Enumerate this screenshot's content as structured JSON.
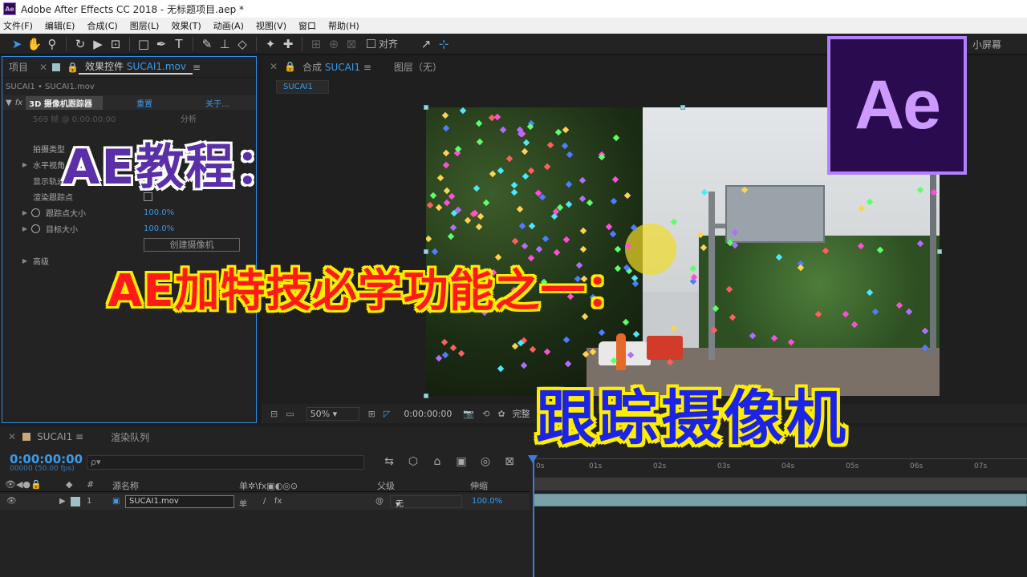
{
  "window": {
    "title": "Adobe After Effects CC 2018 - 无标题项目.aep *",
    "icon_label": "Ae"
  },
  "menubar": [
    "文件(F)",
    "编辑(E)",
    "合成(C)",
    "图层(L)",
    "效果(T)",
    "动画(A)",
    "视图(V)",
    "窗口",
    "帮助(H)"
  ],
  "toolbar": {
    "snap_label": "对齐",
    "small_screen": "小屏幕"
  },
  "left_panel": {
    "tabs": [
      "项目",
      "效果控件"
    ],
    "effect_tab_file": "SUCAI1.mov",
    "breadcrumb": "SUCAI1 • SUCAI1.mov",
    "effect_name": "3D 摄像机跟踪器",
    "reset": "重置",
    "about": "关于...",
    "analyze": "分析",
    "frame_info": "569 帧 @ 0:00:00:00",
    "props": {
      "shoot_type": "拍摄类型",
      "horizontal_fov": "水平视角",
      "show_track_points": "显示轨迹",
      "render_track_points": "渲染跟踪点",
      "track_point_size": "跟踪点大小",
      "track_point_size_val": "100.0%",
      "target_size": "目标大小",
      "target_size_val": "100.0%",
      "create_camera": "创建摄像机",
      "advanced": "高级"
    }
  },
  "comp_panel": {
    "tab_label": "合成",
    "comp_name": "SUCAI1",
    "layer_tab": "图层（无）",
    "subtab": "SUCAI1",
    "footer": {
      "zoom": "50%",
      "timecode": "0:00:00:00",
      "quality": "完整"
    }
  },
  "timeline": {
    "tabs": [
      "SUCAI1",
      "渲染队列"
    ],
    "timecode": "0:00:00:00",
    "timecode_sub": "00000 (50.00 fps)",
    "search_placeholder": "ρ▾",
    "ruler": [
      "0s",
      "01s",
      "02s",
      "03s",
      "04s",
      "05s",
      "06s",
      "07s"
    ],
    "columns": {
      "num": "#",
      "source": "源名称",
      "switches": "单✲\\fx▣◐◎⊙",
      "parent": "父级",
      "stretch": "伸缩"
    },
    "layer": {
      "index": "1",
      "name": "SUCAI1.mov",
      "parent": "无",
      "stretch": "100.0%"
    }
  },
  "overlay": {
    "logo": "Ae",
    "line1": "AE教程：",
    "line2": "AE加特技必学功能之一：",
    "line3": "跟踪摄像机"
  },
  "colors": {
    "accent": "#3b9bea",
    "logo_bg": "#2a0b50",
    "logo_fg": "#cd9bff",
    "line1": "#5a2fa8",
    "line2": "#ff1a1a",
    "line3": "#1a23e6",
    "outline": "#ffee00"
  }
}
